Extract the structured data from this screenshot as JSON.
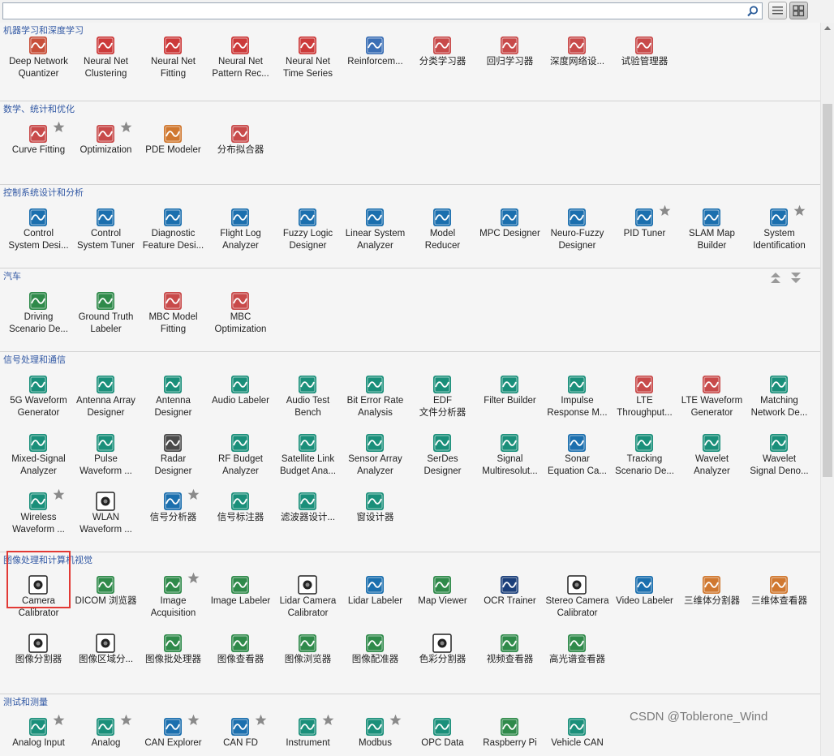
{
  "search": {
    "value": "",
    "placeholder": ""
  },
  "colors": {
    "section_title": "#3158a4",
    "highlight": "#e23a35"
  },
  "sections": [
    {
      "title": "机器学习和深度学习",
      "apps": [
        {
          "label": "Deep Network\nQuantizer",
          "icon": "network-quantizer-icon",
          "color": "#c8503a"
        },
        {
          "label": "Neural Net\nClustering",
          "icon": "neural-net-icon",
          "color": "#cc3a3a"
        },
        {
          "label": "Neural Net\nFitting",
          "icon": "neural-net-icon",
          "color": "#cc3a3a"
        },
        {
          "label": "Neural Net\nPattern Rec...",
          "icon": "neural-net-icon",
          "color": "#cc3a3a"
        },
        {
          "label": "Neural Net\nTime Series",
          "icon": "neural-net-icon",
          "color": "#cc3a3a"
        },
        {
          "label": "Reinforcem...",
          "icon": "reinforcement-icon",
          "color": "#3b6fb5"
        },
        {
          "label": "分类学习器",
          "icon": "classification-icon",
          "color": "#c84a4a"
        },
        {
          "label": "回归学习器",
          "icon": "regression-icon",
          "color": "#c84a4a"
        },
        {
          "label": "深度网络设...",
          "icon": "network-designer-icon",
          "color": "#c84a4a"
        },
        {
          "label": "试验管理器",
          "icon": "experiment-icon",
          "color": "#c84a4a"
        }
      ]
    },
    {
      "title": "数学、统计和优化",
      "apps": [
        {
          "label": "Curve Fitting",
          "icon": "curve-fit-icon",
          "color": "#c84a4a",
          "star": true
        },
        {
          "label": "Optimization",
          "icon": "optimization-icon",
          "color": "#c84a4a",
          "star": true
        },
        {
          "label": "PDE Modeler",
          "icon": "pde-icon",
          "color": "#d07830"
        },
        {
          "label": "分布拟合器",
          "icon": "distribution-icon",
          "color": "#c84a4a"
        }
      ]
    },
    {
      "title": "控制系统设计和分析",
      "apps": [
        {
          "label": "Control\nSystem Desi...",
          "icon": "control-icon",
          "color": "#1b6fae"
        },
        {
          "label": "Control\nSystem Tuner",
          "icon": "control-icon",
          "color": "#1b6fae"
        },
        {
          "label": "Diagnostic\nFeature Desi...",
          "icon": "diagnostic-icon",
          "color": "#1b6fae"
        },
        {
          "label": "Flight Log\nAnalyzer",
          "icon": "flight-icon",
          "color": "#1b6fae"
        },
        {
          "label": "Fuzzy Logic\nDesigner",
          "icon": "fuzzy-icon",
          "color": "#1b6fae"
        },
        {
          "label": "Linear System\nAnalyzer",
          "icon": "linear-system-icon",
          "color": "#1b6fae"
        },
        {
          "label": "Model\nReducer",
          "icon": "model-reducer-icon",
          "color": "#1b6fae"
        },
        {
          "label": "MPC Designer",
          "icon": "mpc-icon",
          "color": "#1b6fae"
        },
        {
          "label": "Neuro-Fuzzy\nDesigner",
          "icon": "neuro-fuzzy-icon",
          "color": "#1b6fae"
        },
        {
          "label": "PID Tuner",
          "icon": "pid-icon",
          "color": "#1b6fae",
          "star": true
        },
        {
          "label": "SLAM Map\nBuilder",
          "icon": "slam-icon",
          "color": "#1b6fae"
        },
        {
          "label": "System\nIdentification",
          "icon": "system-id-icon",
          "color": "#1b6fae",
          "star": true
        }
      ]
    },
    {
      "title": "汽车",
      "apps": [
        {
          "label": "Driving\nScenario De...",
          "icon": "driving-icon",
          "color": "#2f8a4a"
        },
        {
          "label": "Ground Truth\nLabeler",
          "icon": "ground-truth-icon",
          "color": "#2f8a4a"
        },
        {
          "label": "MBC Model\nFitting",
          "icon": "mbc-icon",
          "color": "#c84a4a"
        },
        {
          "label": "MBC\nOptimization",
          "icon": "mbc-icon",
          "color": "#c84a4a"
        }
      ]
    },
    {
      "title": "信号处理和通信",
      "apps": [
        {
          "label": "5G Waveform\nGenerator",
          "icon": "5g-icon",
          "color": "#1a8f7a"
        },
        {
          "label": "Antenna Array\nDesigner",
          "icon": "antenna-icon",
          "color": "#1a8f7a"
        },
        {
          "label": "Antenna\nDesigner",
          "icon": "antenna-icon",
          "color": "#1a8f7a"
        },
        {
          "label": "Audio Labeler",
          "icon": "audio-icon",
          "color": "#1a8f7a"
        },
        {
          "label": "Audio Test\nBench",
          "icon": "audio-test-icon",
          "color": "#1a8f7a"
        },
        {
          "label": "Bit Error Rate\nAnalysis",
          "icon": "ber-icon",
          "color": "#1a8f7a"
        },
        {
          "label": "EDF\n文件分析器",
          "icon": "edf-icon",
          "color": "#1a8f7a"
        },
        {
          "label": "Filter Builder",
          "icon": "filter-icon",
          "color": "#1a8f7a"
        },
        {
          "label": "Impulse\nResponse M...",
          "icon": "impulse-icon",
          "color": "#1a8f7a"
        },
        {
          "label": "LTE\nThroughput...",
          "icon": "lte-icon",
          "color": "#c84a4a"
        },
        {
          "label": "LTE Waveform\nGenerator",
          "icon": "lte-icon",
          "color": "#c84a4a"
        },
        {
          "label": "Matching\nNetwork De...",
          "icon": "matching-icon",
          "color": "#1a8f7a"
        },
        {
          "label": "Mixed-Signal\nAnalyzer",
          "icon": "mixed-signal-icon",
          "color": "#1a8f7a"
        },
        {
          "label": "Pulse\nWaveform ...",
          "icon": "pulse-icon",
          "color": "#1a8f7a"
        },
        {
          "label": "Radar\nDesigner",
          "icon": "radar-icon",
          "color": "#4a4a4a"
        },
        {
          "label": "RF Budget\nAnalyzer",
          "icon": "rf-budget-icon",
          "color": "#1a8f7a"
        },
        {
          "label": "Satellite Link\nBudget Ana...",
          "icon": "satellite-icon",
          "color": "#1a8f7a"
        },
        {
          "label": "Sensor Array\nAnalyzer",
          "icon": "sensor-array-icon",
          "color": "#1a8f7a"
        },
        {
          "label": "SerDes\nDesigner",
          "icon": "serdes-icon",
          "color": "#1a8f7a"
        },
        {
          "label": "Signal\nMultiresolut...",
          "icon": "signal-multi-icon",
          "color": "#1a8f7a"
        },
        {
          "label": "Sonar\nEquation Ca...",
          "icon": "sonar-icon",
          "color": "#1b6fae"
        },
        {
          "label": "Tracking\nScenario De...",
          "icon": "tracking-icon",
          "color": "#1a8f7a"
        },
        {
          "label": "Wavelet\nAnalyzer",
          "icon": "wavelet-icon",
          "color": "#1a8f7a"
        },
        {
          "label": "Wavelet\nSignal Deno...",
          "icon": "wavelet-icon",
          "color": "#1a8f7a"
        },
        {
          "label": "Wireless\nWaveform ...",
          "icon": "wireless-icon",
          "color": "#1a8f7a",
          "star": true
        },
        {
          "label": "WLAN\nWaveform ...",
          "icon": "wifi-icon",
          "color": "#333333"
        },
        {
          "label": "信号分析器",
          "icon": "signal-analyzer-icon",
          "color": "#1b6fae",
          "star": true
        },
        {
          "label": "信号标注器",
          "icon": "signal-labeler-icon",
          "color": "#1a8f7a"
        },
        {
          "label": "滤波器设计...",
          "icon": "filter-designer-icon",
          "color": "#1a8f7a"
        },
        {
          "label": "窗设计器",
          "icon": "window-designer-icon",
          "color": "#1a8f7a"
        }
      ]
    },
    {
      "title": "图像处理和计算机视觉",
      "apps": [
        {
          "label": "Camera\nCalibrator",
          "icon": "camera-icon",
          "color": "#222222"
        },
        {
          "label": "DICOM 浏览器",
          "icon": "dicom-icon",
          "color": "#2f8a4a"
        },
        {
          "label": "Image\nAcquisition",
          "icon": "image-acq-icon",
          "color": "#2f8a4a",
          "star": true
        },
        {
          "label": "Image Labeler",
          "icon": "image-labeler-icon",
          "color": "#2f8a4a"
        },
        {
          "label": "Lidar Camera\nCalibrator",
          "icon": "lidar-camera-icon",
          "color": "#222222"
        },
        {
          "label": "Lidar Labeler",
          "icon": "lidar-labeler-icon",
          "color": "#1b6fae"
        },
        {
          "label": "Map Viewer",
          "icon": "map-icon",
          "color": "#2f8a4a"
        },
        {
          "label": "OCR Trainer",
          "icon": "ocr-icon",
          "color": "#1b3f7a"
        },
        {
          "label": "Stereo Camera\nCalibrator",
          "icon": "camera-icon",
          "color": "#222222"
        },
        {
          "label": "Video Labeler",
          "icon": "video-labeler-icon",
          "color": "#1b6fae"
        },
        {
          "label": "三维体分割器",
          "icon": "volume-seg-icon",
          "color": "#d07830"
        },
        {
          "label": "三维体查看器",
          "icon": "volume-view-icon",
          "color": "#d07830"
        },
        {
          "label": "图像分割器",
          "icon": "image-seg-icon",
          "color": "#333333"
        },
        {
          "label": "图像区域分...",
          "icon": "image-region-icon",
          "color": "#333333"
        },
        {
          "label": "图像批处理器",
          "icon": "image-batch-icon",
          "color": "#2f8a4a"
        },
        {
          "label": "图像查看器",
          "icon": "image-viewer-icon",
          "color": "#2f8a4a"
        },
        {
          "label": "图像浏览器",
          "icon": "image-browser-icon",
          "color": "#2f8a4a"
        },
        {
          "label": "图像配准器",
          "icon": "registration-icon",
          "color": "#2f8a4a"
        },
        {
          "label": "色彩分割器",
          "icon": "color-seg-icon",
          "color": "#333333"
        },
        {
          "label": "视频查看器",
          "icon": "video-viewer-icon",
          "color": "#2f8a4a"
        },
        {
          "label": "高光谱查看器",
          "icon": "hyperspectral-icon",
          "color": "#2f8a4a"
        }
      ]
    },
    {
      "title": "测试和测量",
      "apps": [
        {
          "label": "Analog Input",
          "icon": "daq-icon",
          "color": "#1a8f7a",
          "star": true
        },
        {
          "label": "Analog",
          "icon": "daq-icon",
          "color": "#1a8f7a",
          "star": true
        },
        {
          "label": "CAN Explorer",
          "icon": "can-icon",
          "color": "#1b6fae",
          "star": true
        },
        {
          "label": "CAN FD",
          "icon": "can-icon",
          "color": "#1b6fae",
          "star": true
        },
        {
          "label": "Instrument",
          "icon": "instrument-icon",
          "color": "#1a8f7a",
          "star": true
        },
        {
          "label": "Modbus",
          "icon": "modbus-icon",
          "color": "#1a8f7a",
          "star": true
        },
        {
          "label": "OPC Data",
          "icon": "opc-icon",
          "color": "#1a8f7a"
        },
        {
          "label": "Raspberry Pi",
          "icon": "raspberry-icon",
          "color": "#2f8a4a"
        },
        {
          "label": "Vehicle CAN",
          "icon": "vehicle-can-icon",
          "color": "#1a8f7a"
        }
      ]
    }
  ],
  "watermark": "CSDN @Toblerone_Wind"
}
